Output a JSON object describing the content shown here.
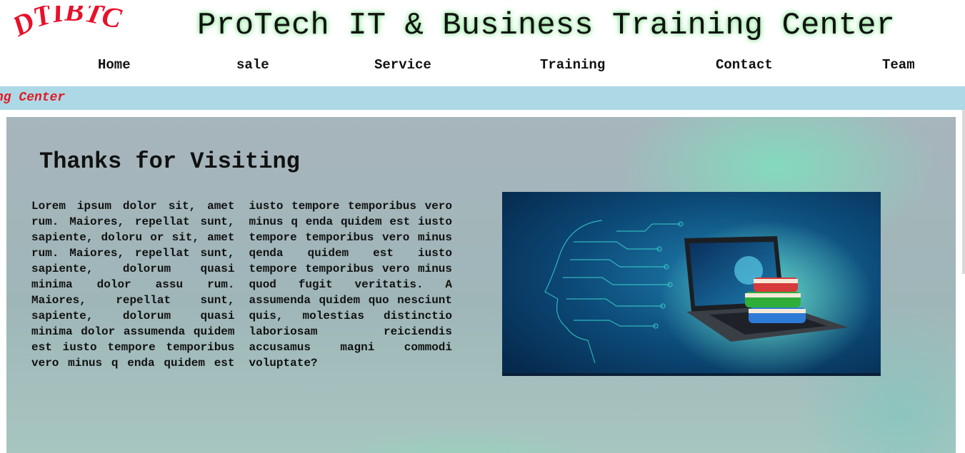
{
  "header": {
    "logo_text": "DTIBTC",
    "site_title": "ProTech IT & Business Training Center"
  },
  "nav": {
    "items": [
      {
        "label": "Home"
      },
      {
        "label": "sale"
      },
      {
        "label": "Service"
      },
      {
        "label": "Training"
      },
      {
        "label": "Contact"
      },
      {
        "label": "Team"
      }
    ]
  },
  "ticker": {
    "text": "ng Center"
  },
  "main": {
    "heading": "Thanks for Visiting",
    "body": "Lorem ipsum dolor sit, amet rum. Maiores, repellat sunt, sapiente, doloru or sit, amet rum. Maiores, repellat sunt, sapiente, dolorum quasi minima dolor assu rum. Maiores, repellat sunt, sapiente, dolorum quasi minima dolor assumenda quidem est iusto tempore temporibus vero minus q enda quidem est iusto tempore temporibus vero minus q enda quidem est iusto tempore temporibus vero minus qenda quidem est iusto tempore temporibus vero minus quod fugit veritatis. A assumenda quidem quo nesciunt quis, molestias distinctio laboriosam reiciendis accusamus magni commodi voluptate?",
    "image_icon": "ai-laptop-books-image"
  },
  "colors": {
    "ticker_bg": "#add8e6",
    "ticker_text": "#e01b24",
    "logo": "#e8102a",
    "title_glow": "#7fdc8a"
  }
}
